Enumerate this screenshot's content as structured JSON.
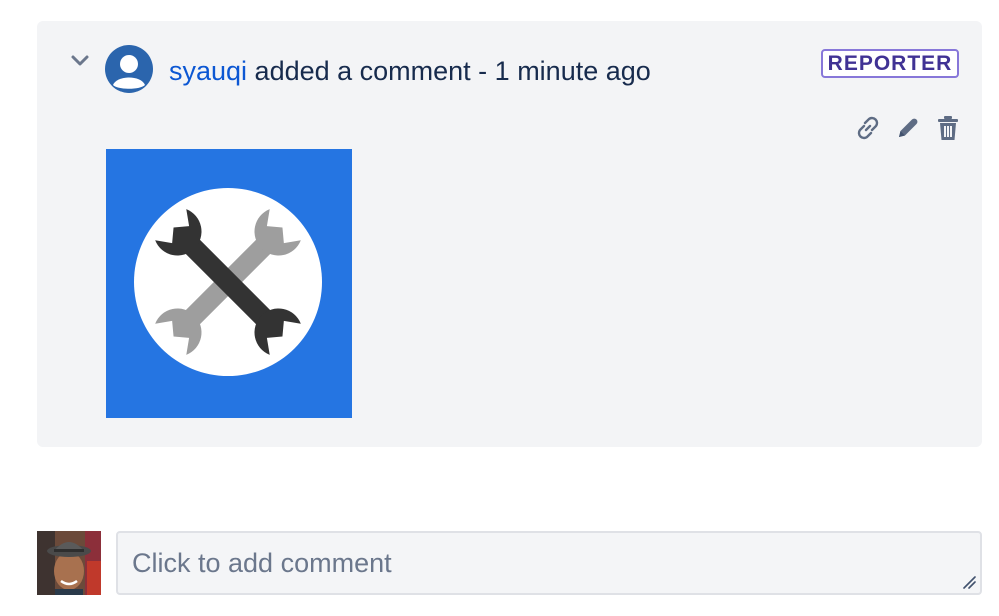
{
  "comment": {
    "author": "syauqi",
    "action_text": " added a comment - 1 minute ago",
    "badge": "REPORTER",
    "icons": {
      "collapse": "chevron-down-icon",
      "avatar": "default-user-avatar",
      "link": "link-icon",
      "edit": "pencil-icon",
      "delete": "trash-icon",
      "attachment": "wrench-tools-icon"
    }
  },
  "composer": {
    "placeholder": "Click to add comment",
    "avatar": "user-photo-avatar"
  },
  "colors": {
    "link": "#0c57d3",
    "badge_border": "#8777d9",
    "badge_text": "#403294",
    "card_bg": "#f3f4f6",
    "attachment_bg": "#2575e2"
  }
}
